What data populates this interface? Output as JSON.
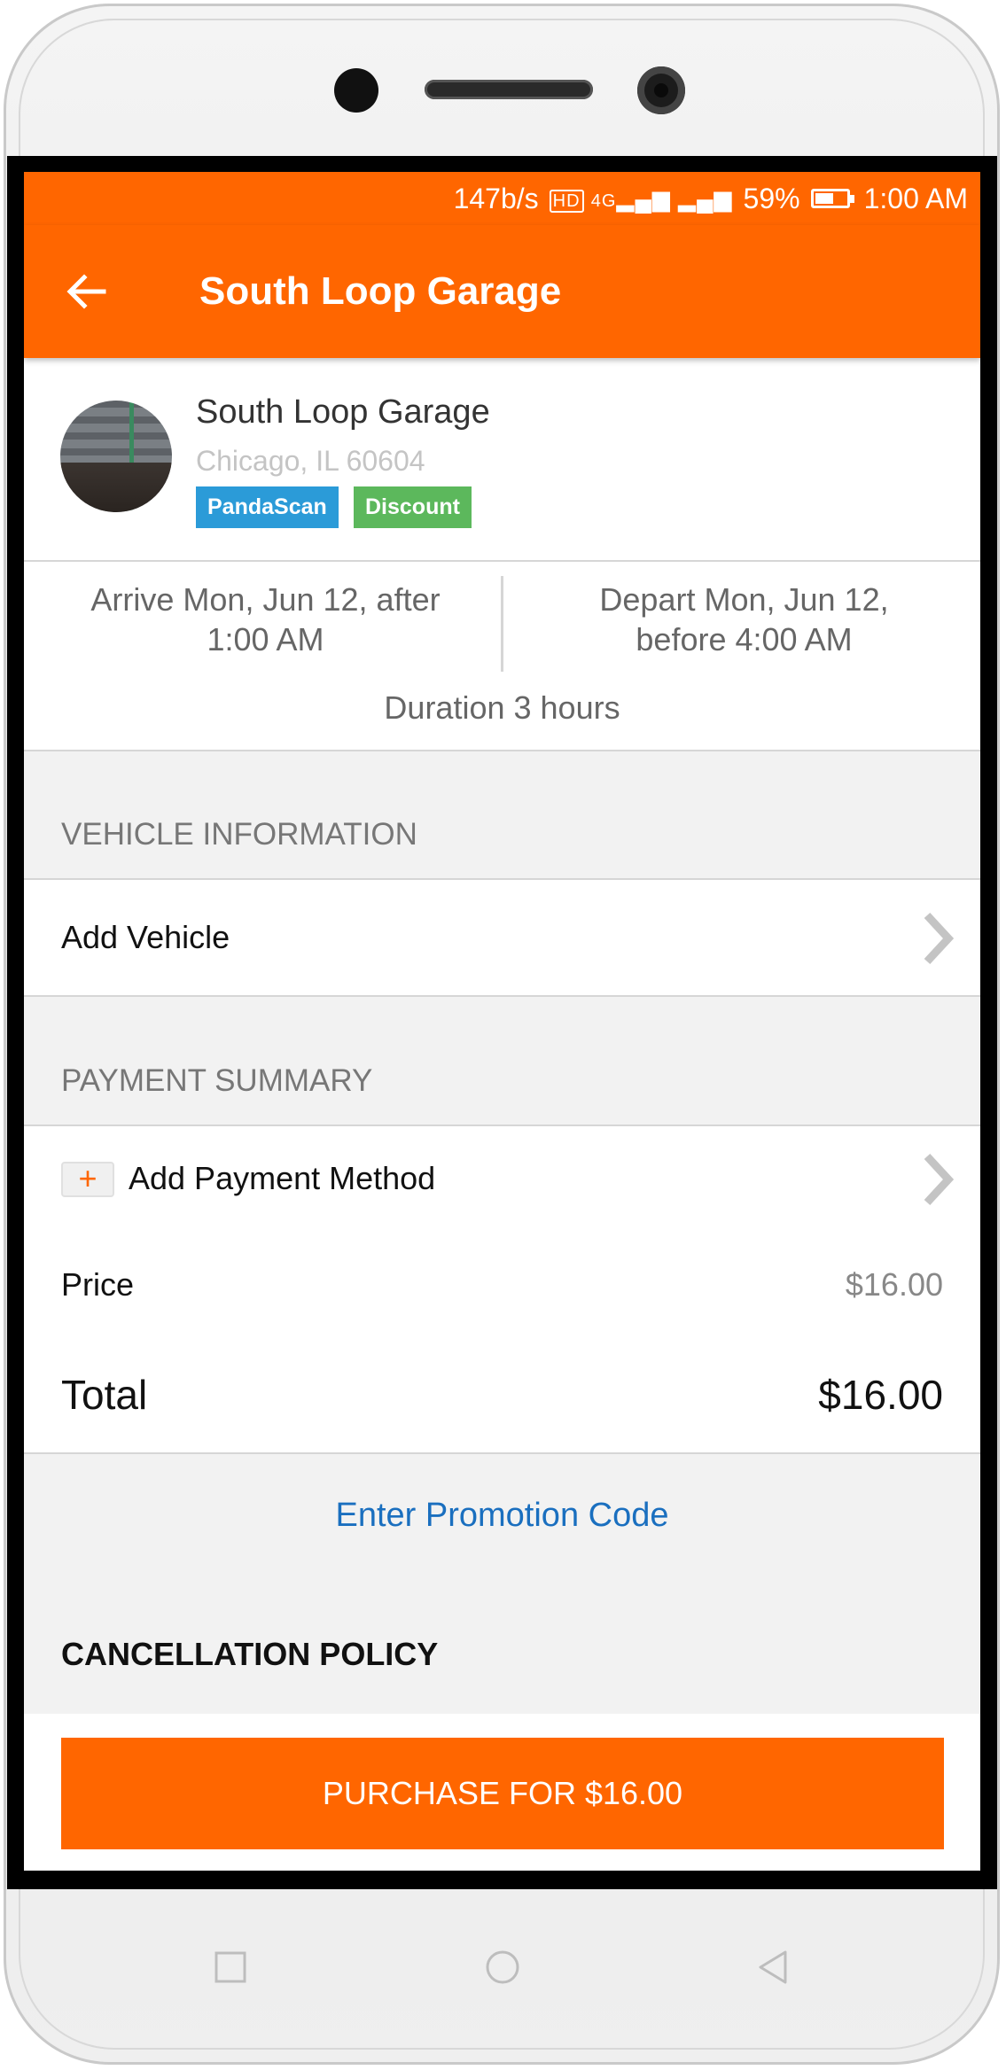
{
  "status_bar": {
    "speed": "147b/s",
    "network": "4G",
    "battery": "59%",
    "time": "1:00 AM"
  },
  "app_bar": {
    "back_icon": "arrow-left-icon",
    "title": "South Loop Garage"
  },
  "garage": {
    "name": "South Loop Garage",
    "address": "Chicago, IL 60604",
    "badges": [
      "PandaScan",
      "Discount"
    ],
    "colors": {
      "pandascan": "#2b9bd8",
      "discount": "#5cb85c"
    }
  },
  "schedule": {
    "arrive_line1": "Arrive Mon, Jun 12, after",
    "arrive_line2": "1:00 AM",
    "depart_line1": "Depart Mon, Jun 12,",
    "depart_line2": "before 4:00 AM",
    "duration": "Duration 3 hours"
  },
  "vehicle": {
    "section_title": "VEHICLE INFORMATION",
    "add_label": "Add Vehicle"
  },
  "payment": {
    "section_title": "PAYMENT SUMMARY",
    "add_method_label": "Add Payment Method",
    "price_label": "Price",
    "price_value": "$16.00",
    "total_label": "Total",
    "total_value": "$16.00"
  },
  "promo": {
    "label": "Enter Promotion Code"
  },
  "cancellation": {
    "title": "CANCELLATION POLICY"
  },
  "purchase": {
    "label": "PURCHASE FOR $16.00"
  },
  "theme": {
    "accent": "#ff6600",
    "link": "#1a6fbf"
  }
}
